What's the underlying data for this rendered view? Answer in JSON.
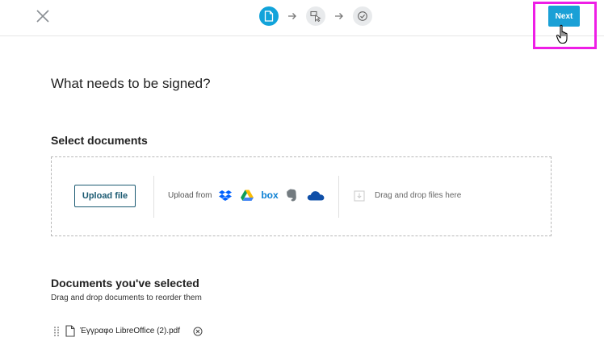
{
  "header": {
    "close_icon": "close-icon",
    "steps": [
      {
        "icon": "document-icon",
        "state": "active"
      },
      {
        "icon": "select-fields-icon",
        "state": "inactive"
      },
      {
        "icon": "check-icon",
        "state": "inactive"
      }
    ],
    "next_label": "Next"
  },
  "main": {
    "page_title": "What needs to be signed?",
    "select_title": "Select documents",
    "upload_label": "Upload file",
    "upload_from_label": "Upload from",
    "providers": [
      "dropbox",
      "google-drive",
      "box",
      "evernote",
      "onedrive"
    ],
    "box_label": "box",
    "drag_drop_label": "Drag and drop files here",
    "selected_title": "Documents you've selected",
    "selected_subtitle": "Drag and drop documents to reorder them",
    "documents": [
      {
        "name": "Έγγραφο LibreOffice (2).pdf"
      }
    ]
  },
  "colors": {
    "accent": "#1aa0d6",
    "highlight": "#ee1ee6",
    "upload_border": "#1b5a72"
  }
}
